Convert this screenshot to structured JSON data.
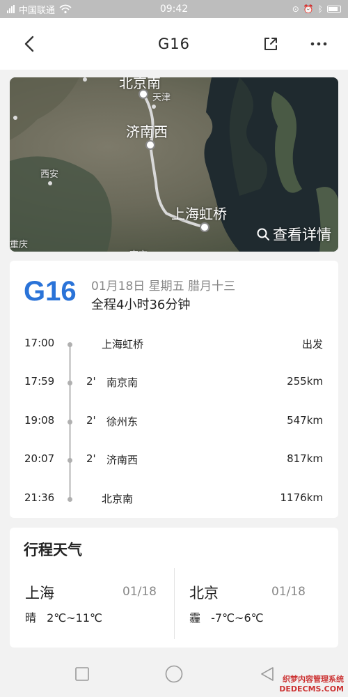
{
  "status_bar": {
    "carrier": "中国联通",
    "time": "09:42"
  },
  "header": {
    "title": "G16"
  },
  "map": {
    "labels": {
      "beijing_south": "北京南",
      "tianjin": "天津",
      "jinan_west": "济南西",
      "xian": "西安",
      "shanghai_hongqiao": "上海虹桥",
      "chongqing": "重庆",
      "nanjing": "南京"
    },
    "detail_label": "查看详情"
  },
  "train": {
    "number": "G16",
    "date": "01月18日 星期五 腊月十三",
    "duration": "全程4小时36分钟",
    "stops": [
      {
        "time": "17:00",
        "dwell": "",
        "name": "上海虹桥",
        "distance": "出发"
      },
      {
        "time": "17:59",
        "dwell": "2'",
        "name": "南京南",
        "distance": "255km"
      },
      {
        "time": "19:08",
        "dwell": "2'",
        "name": "徐州东",
        "distance": "547km"
      },
      {
        "time": "20:07",
        "dwell": "2'",
        "name": "济南西",
        "distance": "817km"
      },
      {
        "time": "21:36",
        "dwell": "",
        "name": "北京南",
        "distance": "1176km"
      }
    ]
  },
  "weather": {
    "title": "行程天气",
    "cities": [
      {
        "city": "上海",
        "date": "01/18",
        "condition": "晴",
        "temp": "2℃~11℃"
      },
      {
        "city": "北京",
        "date": "01/18",
        "condition": "霾",
        "temp": "-7℃~6℃"
      }
    ]
  },
  "watermark": {
    "line1": "织梦内容管理系统",
    "line2": "DEDECMS.COM"
  },
  "colors": {
    "accent": "#2a73d8",
    "status_bar": "#bdbdbd",
    "background": "#f2f2f2"
  }
}
